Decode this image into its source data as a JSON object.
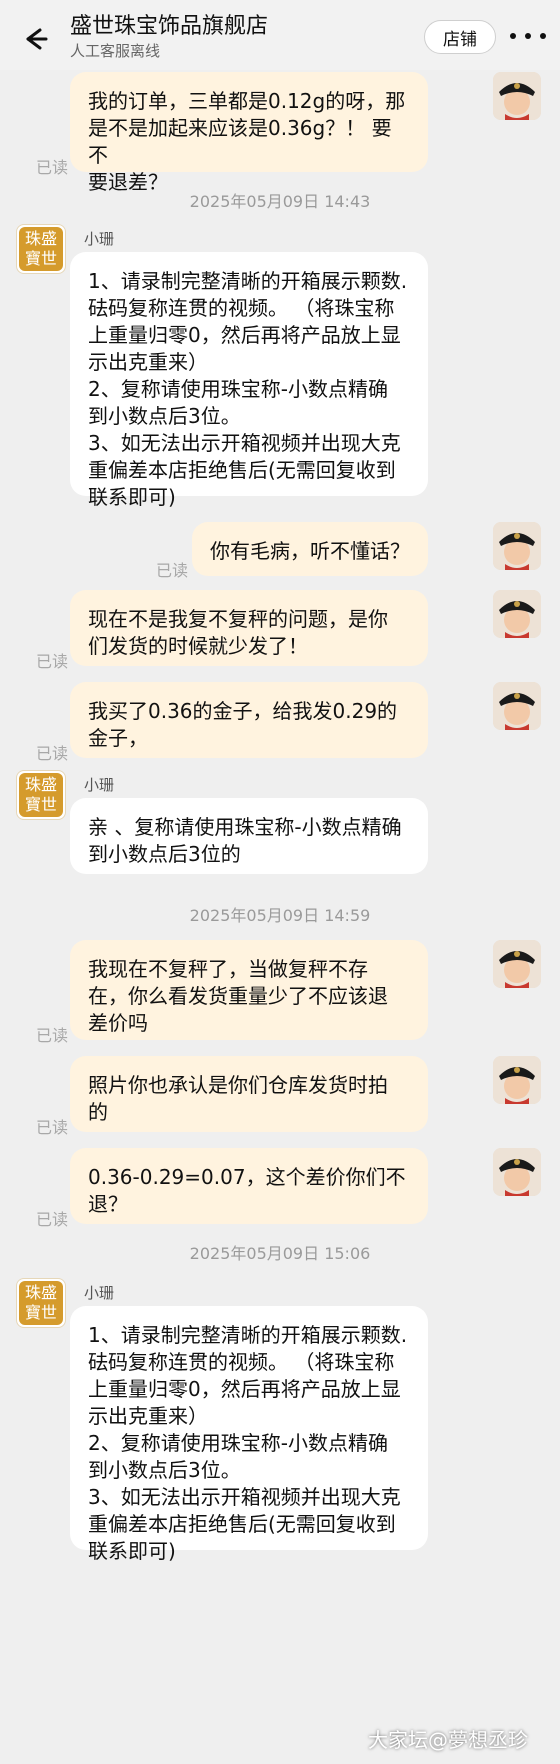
{
  "header": {
    "title": "盛世珠宝饰品旗舰店",
    "subtitle": "人工客服离线",
    "store_button": "店铺"
  },
  "messages": [
    {
      "side": "out",
      "text": "我的订单，三单都是0.12g的呀，那\n是不是加起来应该是0.36g？！ 要不\n要退差？",
      "read": "已读"
    },
    {
      "timestamp": "2025年05月09日 14:43"
    },
    {
      "side": "in",
      "sender": "小珊",
      "text": "1、请录制完整清晰的开箱展示颗数.\n砝码复称连贯的视频。 （将珠宝称\n上重量归零0，然后再将产品放上显\n示出克重来）\n2、复称请使用珠宝称-小数点精确\n到小数点后3位。\n3、如无法出示开箱视频并出现大克\n重偏差本店拒绝售后(无需回复收到\n联系即可)"
    },
    {
      "side": "out",
      "text": "你有毛病，听不懂话？",
      "read": "已读"
    },
    {
      "side": "out",
      "text": "现在不是我复不复秤的问题，是你\n们发货的时候就少发了！",
      "read": "已读"
    },
    {
      "side": "out",
      "text": "我买了0.36的金子，给我发0.29的\n金子，",
      "read": "已读"
    },
    {
      "side": "in",
      "sender": "小珊",
      "text": "亲 、复称请使用珠宝称-小数点精确\n到小数点后3位的"
    },
    {
      "timestamp": "2025年05月09日 14:59"
    },
    {
      "side": "out",
      "text": "我现在不复秤了，当做复秤不存\n在，你么看发货重量少了不应该退\n差价吗",
      "read": "已读"
    },
    {
      "side": "out",
      "text": "照片你也承认是你们仓库发货时拍\n的",
      "read": "已读"
    },
    {
      "side": "out",
      "text": "0.36-0.29=0.07，这个差价你们不\n退？",
      "read": "已读"
    },
    {
      "timestamp": "2025年05月09日 15:06"
    },
    {
      "side": "in",
      "sender": "小珊",
      "text": "1、请录制完整清晰的开箱展示颗数.\n砝码复称连贯的视频。 （将珠宝称\n上重量归零0，然后再将产品放上显\n示出克重来）\n2、复称请使用珠宝称-小数点精确\n到小数点后3位。\n3、如无法出示开箱视频并出现大克\n重偏差本店拒绝售后(无需回复收到\n联系即可)"
    }
  ],
  "shop_avatar_text": "珠盛寶世",
  "watermark": "大家坛@夢想丞珍",
  "colors": {
    "outgoing_bubble": "#fff3df",
    "incoming_bubble": "#ffffff",
    "background": "#efefef",
    "shop_logo": "#d59b2c"
  }
}
